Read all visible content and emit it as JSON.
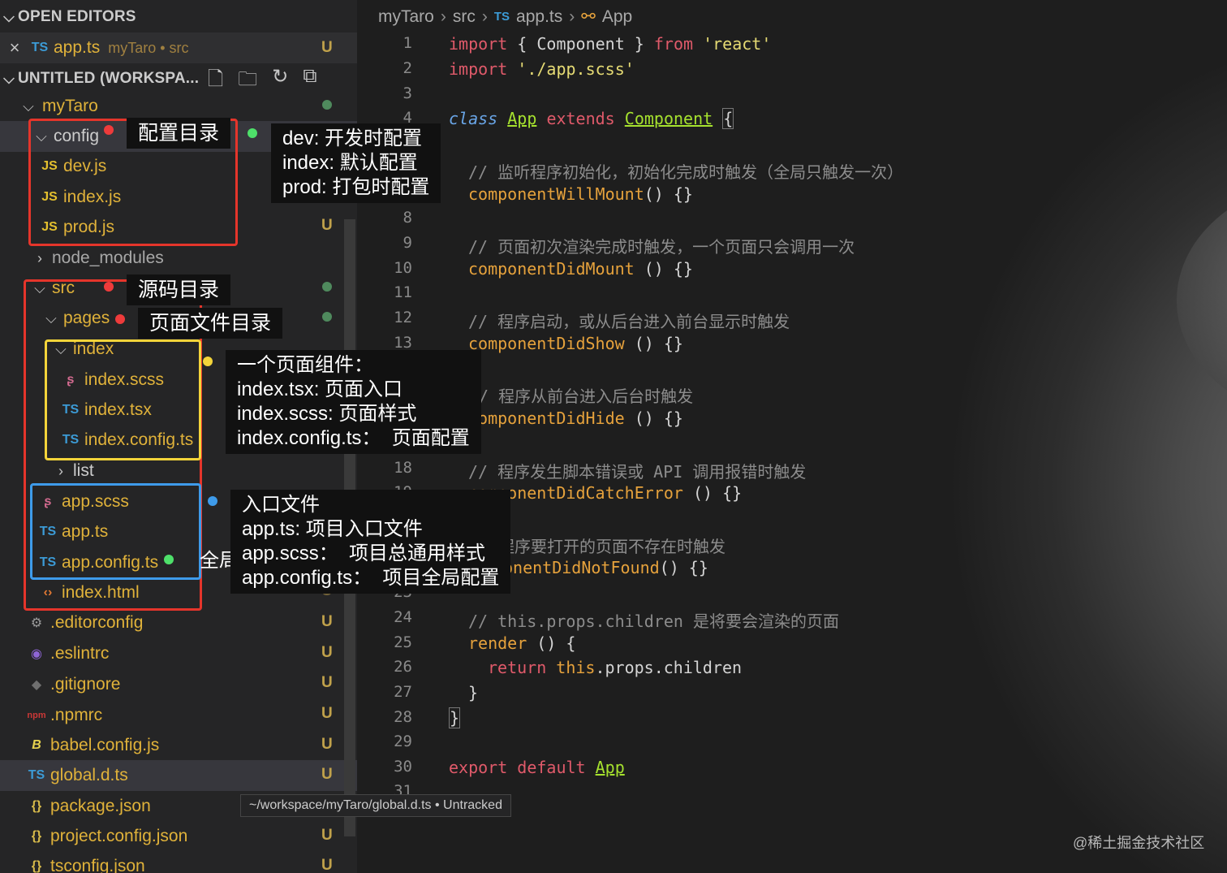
{
  "sidebar": {
    "open_editors": {
      "title": "OPEN EDITORS",
      "file": "app.ts",
      "context": "myTaro • src",
      "status": "U"
    },
    "workspace": {
      "title": "UNTITLED (WORKSPA...",
      "icons": [
        "new-file-icon",
        "new-folder-icon",
        "refresh-icon",
        "collapse-all-icon"
      ]
    },
    "tree": [
      {
        "label": "myTaro",
        "status": ""
      },
      {
        "label": "config",
        "status": ""
      },
      {
        "label": "dev.js",
        "status": ""
      },
      {
        "label": "index.js",
        "status": ""
      },
      {
        "label": "prod.js",
        "status": "U"
      },
      {
        "label": "node_modules",
        "status": ""
      },
      {
        "label": "src",
        "status": ""
      },
      {
        "label": "pages",
        "status": ""
      },
      {
        "label": "index",
        "status": ""
      },
      {
        "label": "index.scss",
        "status": ""
      },
      {
        "label": "index.tsx",
        "status": ""
      },
      {
        "label": "index.config.ts",
        "status": ""
      },
      {
        "label": "list",
        "status": ""
      },
      {
        "label": "app.scss",
        "status": ""
      },
      {
        "label": "app.ts",
        "status": ""
      },
      {
        "label": "app.config.ts",
        "status": ""
      },
      {
        "label": "index.html",
        "status": "U"
      },
      {
        "label": ".editorconfig",
        "status": "U"
      },
      {
        "label": ".eslintrc",
        "status": "U"
      },
      {
        "label": ".gitignore",
        "status": "U"
      },
      {
        "label": ".npmrc",
        "status": "U"
      },
      {
        "label": "babel.config.js",
        "status": "U"
      },
      {
        "label": "global.d.ts",
        "status": "U"
      },
      {
        "label": "package.json",
        "status": ""
      },
      {
        "label": "project.config.json",
        "status": "U"
      },
      {
        "label": "tsconfig.json",
        "status": "U"
      }
    ],
    "icon_labels": {
      "ts": "TS",
      "js": "JS",
      "npm": "npm"
    }
  },
  "tooltip": "~/workspace/myTaro/global.d.ts • Untracked",
  "breadcrumb": [
    "myTaro",
    "src",
    "app.ts",
    "App"
  ],
  "editor": {
    "line_numbers": [
      "1",
      "2",
      "3",
      "4",
      "8",
      "9",
      "10",
      "11",
      "12",
      "13",
      "14",
      "18",
      "19",
      "20",
      "23",
      "24",
      "25",
      "26",
      "27",
      "28",
      "29",
      "30",
      "31"
    ],
    "code": {
      "l1_import": "import",
      "l1_mid": " { Component } ",
      "l1_from": "from",
      "l1_str": " 'react'",
      "l2_import": "import",
      "l2_str": " './app.scss'",
      "l4_class": "class",
      "l4_name": "App",
      "l4_extends": "extends",
      "l4_parent": "Component",
      "l4_brace": "{",
      "c1": "// 监听程序初始化，初始化完成时触发（全局只触发一次）",
      "f1": "componentWillMount",
      "f1_rest": "() {}",
      "c2": "// 页面初次渲染完成时触发，一个页面只会调用一次",
      "f2": "componentDidMount",
      "f2_rest": " () {}",
      "c3": "// 程序启动，或从后台进入前台显示时触发",
      "f3": "componentDidShow",
      "f3_rest": " () {}",
      "c4": "/ 程序从前台进入后台时触发",
      "f4": "componentDidHide",
      "f4_rest": " () {}",
      "c5": "// 程序发生脚本错误或 API 调用报错时触发",
      "f5": "componentDidCatchError",
      "f5_rest": " () {}",
      "c6": "程序要打开的页面不存在时触发",
      "f6": "onentDidNotFound",
      "f6_rest": "() {}",
      "c7": "// this.props.children 是将要会渲染的页面",
      "f7": "render",
      "f7_rest": " () {",
      "l26_return": "return",
      "l26_this": "this",
      "l26_rest": ".props.children",
      "l27": "}",
      "l28": "}",
      "l30_export": "export",
      "l30_default": "default",
      "l30_app": "App"
    }
  },
  "annotations": {
    "config_label": "配置目录",
    "config_desc": "dev: 开发时配置\nindex: 默认配置\nprod: 打包时配置",
    "src_label": "源码目录",
    "pages_label": "页面文件目录",
    "page_desc": "一个页面组件：\nindex.tsx: 页面入口\nindex.scss: 页面样式\nindex.config.ts：  页面配置",
    "entry_desc": "入口文件\napp.ts: 项目入口文件\napp.scss：  项目总通用样式\napp.config.ts：  项目全局配置",
    "global_config": "全局配置"
  },
  "watermark": "@稀土掘金技术社区",
  "colors": {
    "red": "#e5352b",
    "yellow": "#f3d43a",
    "blue": "#3e9bea",
    "green": "#4ee06a"
  }
}
